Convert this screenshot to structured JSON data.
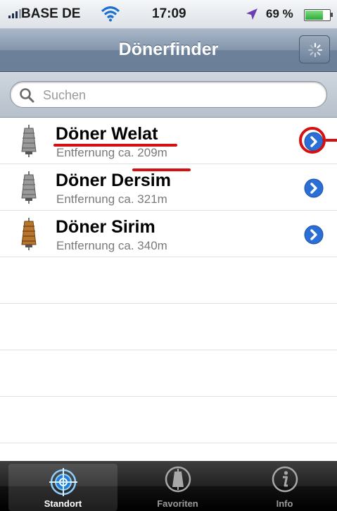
{
  "status_bar": {
    "carrier": "BASE DE",
    "time": "17:09",
    "battery_percent": "69 %",
    "battery_level": 0.69,
    "icons": [
      "signal-icon",
      "wifi-icon",
      "location-arrow-icon",
      "battery-icon"
    ]
  },
  "nav": {
    "title": "Dönerfinder",
    "refresh_icon": "activity-spinner-icon"
  },
  "search": {
    "placeholder": "Suchen",
    "value": ""
  },
  "list": {
    "items": [
      {
        "name": "Döner Welat",
        "distance": "Entfernung ca. 209m",
        "icon_color": "gray"
      },
      {
        "name": "Döner Dersim",
        "distance": "Entfernung ca. 321m",
        "icon_color": "gray"
      },
      {
        "name": "Döner Sirim",
        "distance": "Entfernung ca. 340m",
        "icon_color": "brown"
      }
    ],
    "annotation_color": "#d41010"
  },
  "tabbar": {
    "tabs": [
      {
        "label": "Standort",
        "icon": "location-target-icon",
        "selected": true
      },
      {
        "label": "Favoriten",
        "icon": "doner-favorite-icon",
        "selected": false
      },
      {
        "label": "Info",
        "icon": "info-icon",
        "selected": false
      }
    ]
  },
  "colors": {
    "nav_bar": "#7f92aa",
    "disclosure_blue": "#2a6fd6",
    "annotation_red": "#d41010"
  }
}
